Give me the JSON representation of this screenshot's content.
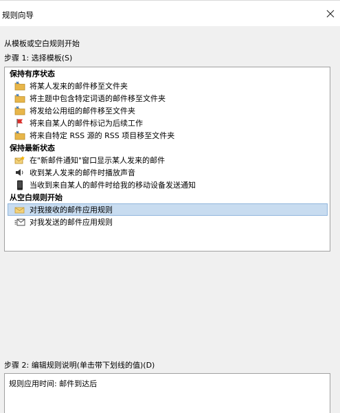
{
  "window": {
    "title": "规则向导"
  },
  "intro": "从模板或空白规则开始",
  "step1": {
    "label": "步骤 1: 选择模板(S)"
  },
  "groups": [
    {
      "title": "保持有序状态",
      "items": [
        {
          "icon": "folder-move-icon",
          "label": "将某人发来的邮件移至文件夹"
        },
        {
          "icon": "folder-move-icon",
          "label": "将主题中包含特定词语的邮件移至文件夹"
        },
        {
          "icon": "folder-move-icon",
          "label": "将发给公用组的邮件移至文件夹"
        },
        {
          "icon": "red-flag-icon",
          "label": "将来自某人的邮件标记为后续工作"
        },
        {
          "icon": "folder-move-icon",
          "label": "将来自特定 RSS 源的 RSS 项目移至文件夹"
        }
      ]
    },
    {
      "title": "保持最新状态",
      "items": [
        {
          "icon": "new-mail-alert-icon",
          "label": "在\"新邮件通知\"窗口显示某人发来的邮件"
        },
        {
          "icon": "speaker-icon",
          "label": "收到某人发来的邮件时播放声音"
        },
        {
          "icon": "mobile-device-icon",
          "label": "当收到来自某人的邮件时给我的移动设备发送通知"
        }
      ]
    },
    {
      "title": "从空白规则开始",
      "items": [
        {
          "icon": "inbox-rule-icon",
          "label": "对我接收的邮件应用规则",
          "selected": true
        },
        {
          "icon": "outbox-rule-icon",
          "label": "对我发送的邮件应用规则"
        }
      ]
    }
  ],
  "step2": {
    "label": "步骤 2: 编辑规则说明(单击带下划线的值)(D)"
  },
  "description": {
    "text": "规则应用时间: 邮件到达后"
  },
  "colors": {
    "selection": "#c8dcf0",
    "folder": "#e8b64a",
    "flag": "#d9302c"
  }
}
